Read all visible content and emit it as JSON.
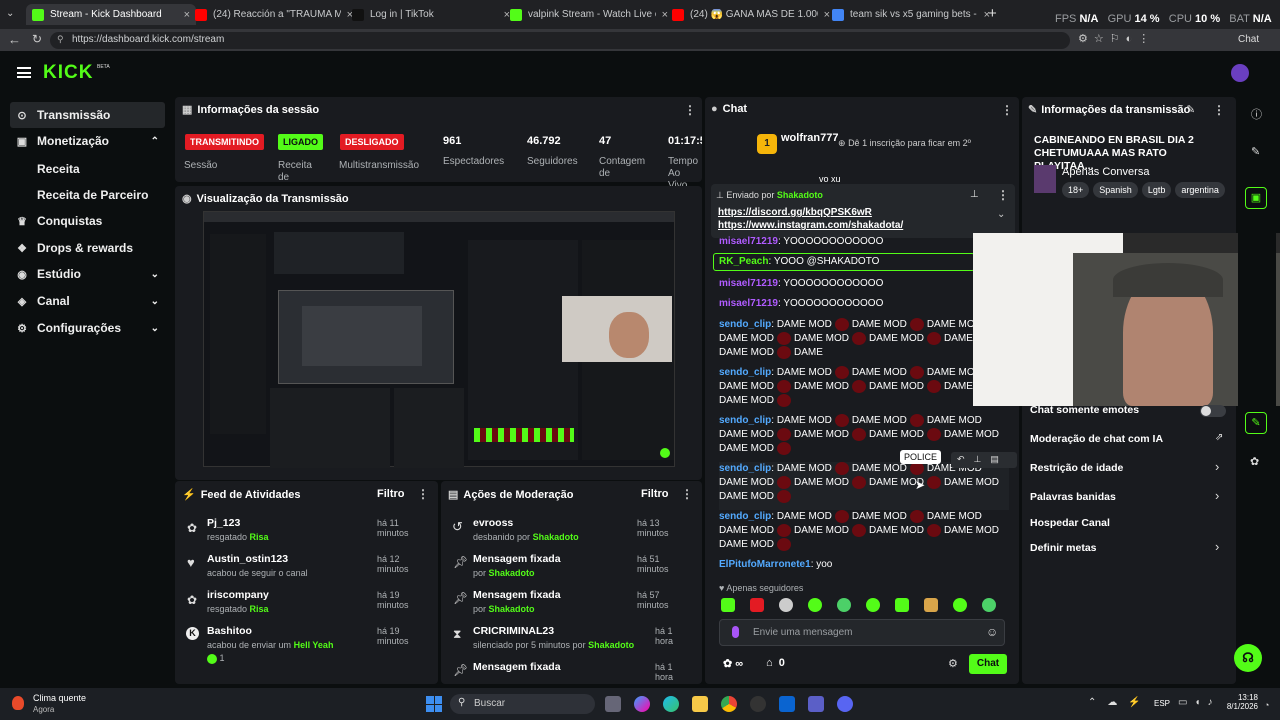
{
  "browser": {
    "tabs": [
      {
        "title": "Stream - Kick Dashboard",
        "color": "#53fc18"
      },
      {
        "title": "(24) Reacción a \"TRAUMA MARGI...",
        "color": "#ff0000"
      },
      {
        "title": "Log in | TikTok",
        "color": "#111111"
      },
      {
        "title": "valpink Stream - Watch Live on Ki...",
        "color": "#53fc18"
      },
      {
        "title": "(24) 😱 GANA MÁS DE 1.000 SOLE...",
        "color": "#ff0000"
      },
      {
        "title": "team sik vs x5 gaming bets - Búsq...",
        "color": "#4285f4"
      }
    ],
    "url": "https://dashboard.kick.com/stream",
    "perf": {
      "fps_label": "FPS",
      "fps": "N/A",
      "gpu_label": "GPU",
      "gpu": "14 %",
      "cpu_label": "CPU",
      "cpu": "10 %",
      "bat_label": "BAT",
      "bat": "N/A"
    },
    "chat_label": "Chat"
  },
  "app": {
    "logo": "KICK",
    "logo_beta": "BETA",
    "accent": "#53fc18"
  },
  "sidebar": {
    "items": [
      {
        "label": "Transmissão",
        "icon": "broadcast-icon"
      },
      {
        "label": "Monetização",
        "icon": "money-icon"
      },
      {
        "label": "Conquistas",
        "icon": "trophy-icon"
      },
      {
        "label": "Drops & rewards",
        "icon": "gift-icon"
      },
      {
        "label": "Estúdio",
        "icon": "studio-icon"
      },
      {
        "label": "Canal",
        "icon": "channel-icon"
      },
      {
        "label": "Configurações",
        "icon": "gear-icon"
      }
    ],
    "sub": [
      "Receita",
      "Receita de Parceiro"
    ]
  },
  "session": {
    "title": "Informações da sessão",
    "badges": [
      {
        "text": "TRANSMITINDO",
        "label": "Sessão",
        "color": "#e31b23"
      },
      {
        "text": "LIGADO",
        "label": "Receita de",
        "color": "#53fc18"
      },
      {
        "text": "DESLIGADO",
        "label": "Multistransmissão",
        "color": "#e31b23"
      }
    ],
    "stats": [
      {
        "value": "961",
        "label": "Espectadores"
      },
      {
        "value": "46.792",
        "label": "Seguidores"
      },
      {
        "value": "47",
        "label": "Contagem de"
      },
      {
        "value": "01:17:5",
        "label": "Tempo Ao Vivo"
      }
    ]
  },
  "preview": {
    "title": "Visualização da Transmissão"
  },
  "activity": {
    "title": "Feed de Atividades",
    "filter": "Filtro",
    "rows": [
      {
        "name": "Pj_123",
        "text": "resgatado",
        "hl": "Risa",
        "time": "há 11 minutos"
      },
      {
        "name": "Austin_ostin123",
        "text": "acabou de seguir o canal",
        "hl": "",
        "time": "há 12 minutos"
      },
      {
        "name": "iriscompany",
        "text": "resgatado",
        "hl": "Risa",
        "time": "há 19 minutos"
      },
      {
        "name": "Bashitoo",
        "text": "acabou de enviar um",
        "hl": "Hell Yeah",
        "time": "há 19 minutos",
        "extra": "1"
      }
    ]
  },
  "moderation": {
    "title": "Ações de Moderação",
    "filter": "Filtro",
    "rows": [
      {
        "name": "evrooss",
        "text": "desbanido por",
        "hl": "Shakadoto",
        "time": "há 13 minutos"
      },
      {
        "name": "Mensagem fixada",
        "text": "por",
        "hl": "Shakadoto",
        "time": "há 51 minutos"
      },
      {
        "name": "Mensagem fixada",
        "text": "por",
        "hl": "Shakadoto",
        "time": "há 57 minutos"
      },
      {
        "name": "CRICRIMINAL23",
        "text": "silenciado por 5 minutos por",
        "hl": "Shakadoto",
        "time": "há 1 hora"
      },
      {
        "name": "Mensagem fixada",
        "text": "",
        "hl": "",
        "time": "há 1 hora"
      }
    ]
  },
  "chat": {
    "title": "Chat",
    "gifter": "wolfran777",
    "gifter_count": "1",
    "gift_goal": "Dê 1 inscrição para ficar em 2º",
    "pinned_by": "Enviado por",
    "pinned_user": "Shakadoto",
    "pinned_links": [
      "https://discord.gg/kbqQPSK6wR",
      "https://www.instagram.com/shakadota/"
    ],
    "partial_top": "vo xu",
    "messages": [
      {
        "user": "misael71219",
        "color": "#b05cff",
        "text": "YOOOOOOOOOOOO"
      },
      {
        "user": "RK_Peach",
        "color": "#53fc18",
        "text": "YOOO @SHAKADOTO"
      },
      {
        "user": "misael71219",
        "color": "#b05cff",
        "text": "YOOOOOOOOOOOO"
      },
      {
        "user": "misael71219",
        "color": "#b05cff",
        "text": "YOOOOOOOOOOOO"
      }
    ],
    "spam_user": "sendo_clip",
    "spam_word": "DAME MOD",
    "spam_last": "DAME",
    "last_user": "ElPitufoMarronete1",
    "last_text": "yoo",
    "tooltip": "POLICE",
    "followers_only": "Apenas seguidores",
    "input_placeholder": "Envie uma mensagem",
    "infinity": "∞",
    "count": "0",
    "send": "Chat"
  },
  "info": {
    "title": "Informações da transmissão",
    "stream_title": "CABINEANDO EN BRASIL DIA 2 CHETUMUAAA MAS RATO PLAYITAA...",
    "category": "Apenas Conversa",
    "tags": [
      "18+",
      "Spanish",
      "Lgtb",
      "argentina"
    ],
    "settings": [
      "Chat somente emotes",
      "Moderação de chat com IA",
      "Restrição de idade",
      "Palavras banidas",
      "Hospedar Canal",
      "Definir metas"
    ]
  },
  "taskbar": {
    "weather": "Clima quente",
    "weather_sub": "Agora",
    "search": "Buscar",
    "lang": "ESP",
    "time": "13:18",
    "date": "8/1/2026"
  }
}
